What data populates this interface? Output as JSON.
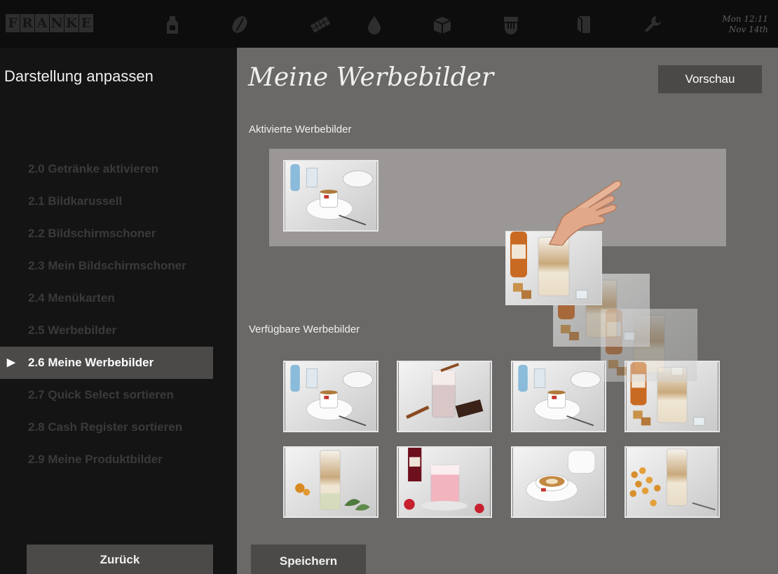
{
  "header": {
    "logo_letters": [
      "F",
      "R",
      "A",
      "N",
      "K",
      "E"
    ],
    "icons": [
      "milk-icon",
      "coffee-bean-icon",
      "chocolate-icon",
      "water-drop-icon",
      "box-icon",
      "cup-cleaning-icon",
      "door-icon",
      "wrench-icon"
    ],
    "date_line1": "Mon 12:11",
    "date_line2": "Nov 14th"
  },
  "sidebar": {
    "title": "Darstellung anpassen",
    "items": [
      {
        "label": "2.0 Getränke aktivieren",
        "active": false
      },
      {
        "label": "2.1 Bildkarussell",
        "active": false
      },
      {
        "label": "2.2 Bildschirmschoner",
        "active": false
      },
      {
        "label": "2.3 Mein Bildschirmschoner",
        "active": false
      },
      {
        "label": "2.4 Menükarten",
        "active": false
      },
      {
        "label": "2.5 Werbebilder",
        "active": false
      },
      {
        "label": "2.6 Meine Werbebilder",
        "active": true
      },
      {
        "label": "2.7 Quick Select sortieren",
        "active": false
      },
      {
        "label": "2.8 Cash Register sortieren",
        "active": false
      },
      {
        "label": "2.9 Meine Produktbilder",
        "active": false
      }
    ],
    "active_marker": "▶",
    "back_label": "Zurück"
  },
  "main": {
    "title": "Meine Werbebilder",
    "preview_label": "Vorschau",
    "active_section_label": "Aktivierte Werbebilder",
    "available_section_label": "Verfügbare Werbebilder",
    "save_label": "Speichern",
    "active_images": [
      "espresso-with-water"
    ],
    "available_images": [
      "espresso-with-water",
      "chocolate-drink-cinnamon",
      "espresso-with-water",
      "latte-macchiato-syrup",
      "latte-layered-glass",
      "strawberry-milk-drink",
      "cappuccino-cup",
      "latte-with-cookies"
    ],
    "dragging_image": "latte-macchiato-syrup"
  },
  "colors": {
    "background": "#6a6967",
    "sidebar": "#141414",
    "active_item": "#4b4a49",
    "active_panel": "#9a9796"
  }
}
